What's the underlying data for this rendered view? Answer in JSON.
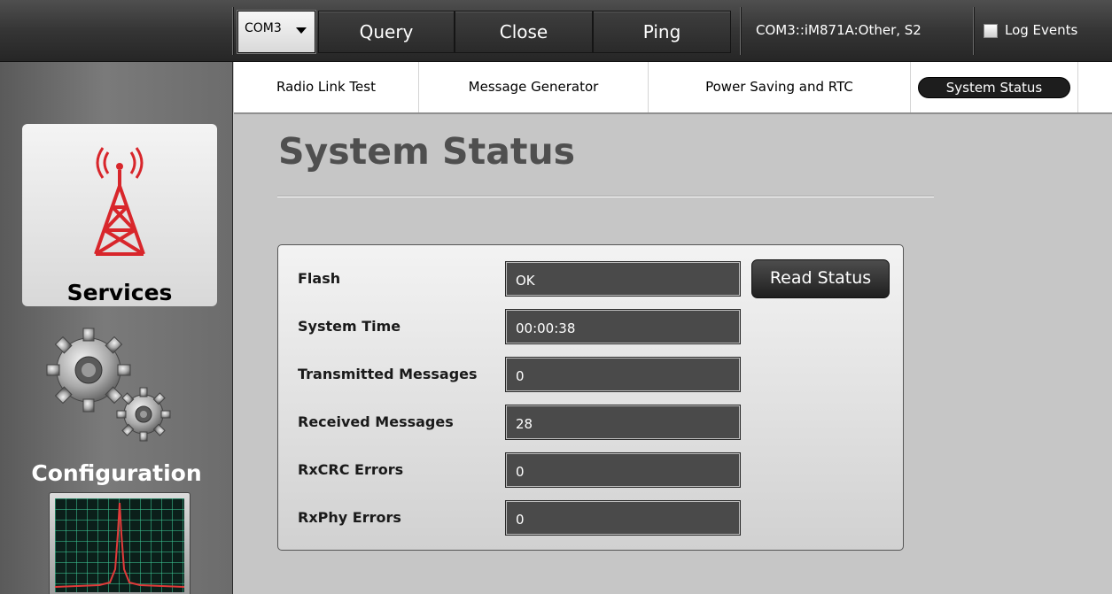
{
  "toolbar": {
    "port_select": "COM3",
    "query_label": "Query",
    "close_label": "Close",
    "ping_label": "Ping",
    "port_info": "COM3::iM871A:Other, S2",
    "log_events_label": "Log Events",
    "log_events_checked": false
  },
  "sidebar": {
    "services_label": "Services",
    "configuration_label": "Configuration"
  },
  "tabs": [
    {
      "label": "Radio Link Test",
      "active": false
    },
    {
      "label": "Message Generator",
      "active": false
    },
    {
      "label": "Power Saving and RTC",
      "active": false
    },
    {
      "label": "System Status",
      "active": true
    }
  ],
  "page": {
    "title": "System Status",
    "read_status_label": "Read Status",
    "fields": [
      {
        "label": "Flash",
        "value": "OK"
      },
      {
        "label": "System Time",
        "value": "00:00:38"
      },
      {
        "label": "Transmitted Messages",
        "value": "0"
      },
      {
        "label": "Received Messages",
        "value": "28"
      },
      {
        "label": "RxCRC Errors",
        "value": "0"
      },
      {
        "label": "RxPhy Errors",
        "value": "0"
      }
    ]
  },
  "colors": {
    "accent_tower": "#d8262b",
    "monitor_trace": "#e23a3a"
  }
}
